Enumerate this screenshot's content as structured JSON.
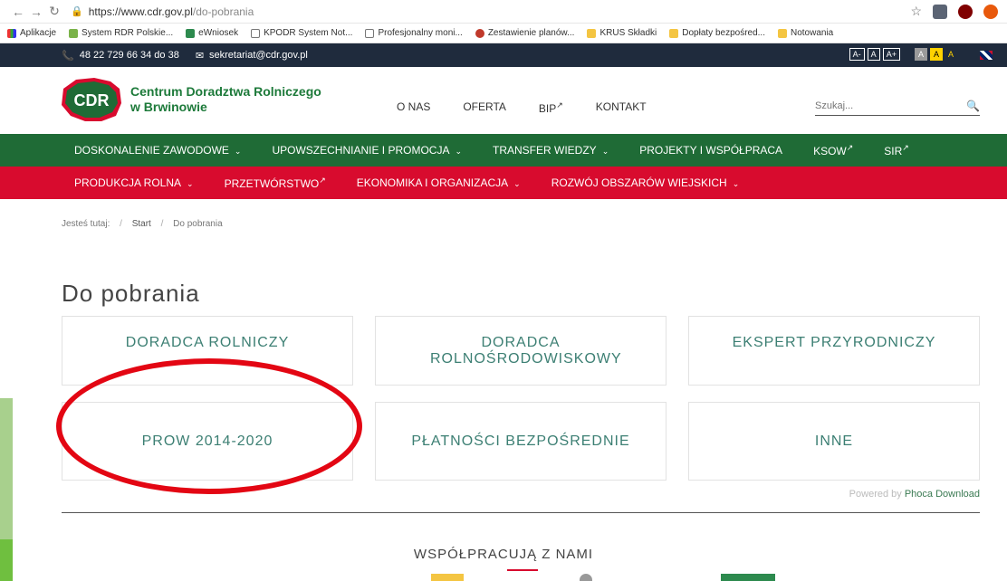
{
  "browser": {
    "url_base": "https://www.cdr.gov.pl",
    "url_path": "/do-pobrania",
    "bookmarks": [
      "Aplikacje",
      "System RDR Polskie...",
      "eWniosek",
      "KPODR System Not...",
      "Profesjonalny moni...",
      "Zestawienie planów...",
      "KRUS Składki",
      "Dopłaty bezpośred...",
      "Notowania"
    ]
  },
  "topbar": {
    "phone": "48 22 729 66 34 do 38",
    "email": "sekretariat@cdr.gov.pl",
    "a11y": [
      "A-",
      "A",
      "A+",
      "A",
      "A",
      "A"
    ]
  },
  "logo": {
    "mark": "CDR",
    "line1": "Centrum Doradztwa Rolniczego",
    "line2": "w Brwinowie"
  },
  "mainnav": [
    "O NAS",
    "OFERTA",
    "BIP",
    "KONTAKT"
  ],
  "search": {
    "placeholder": "Szukaj..."
  },
  "greenmenu": [
    "DOSKONALENIE ZAWODOWE",
    "UPOWSZECHNIANIE I PROMOCJA",
    "TRANSFER WIEDZY",
    "PROJEKTY I WSPÓŁPRACA",
    "KSOW",
    "SIR"
  ],
  "redmenu": [
    "PRODUKCJA ROLNA",
    "PRZETWÓRSTWO",
    "EKONOMIKA I ORGANIZACJA",
    "ROZWÓJ OBSZARÓW WIEJSKICH"
  ],
  "breadcrumb": {
    "label": "Jesteś tutaj:",
    "items": [
      "Start",
      "Do pobrania"
    ]
  },
  "page": {
    "title": "Do pobrania"
  },
  "tiles": [
    "DORADCA ROLNICZY",
    "DORADCA ROLNOŚRODOWISKOWY",
    "EKSPERT PRZYRODNICZY",
    "PROW 2014-2020",
    "PŁATNOŚCI BEZPOŚREDNIE",
    "INNE"
  ],
  "powered": {
    "prefix": "Powered by",
    "link": "Phoca Download"
  },
  "partners": {
    "title": "WSPÓŁPRACUJĄ Z NAMI"
  }
}
